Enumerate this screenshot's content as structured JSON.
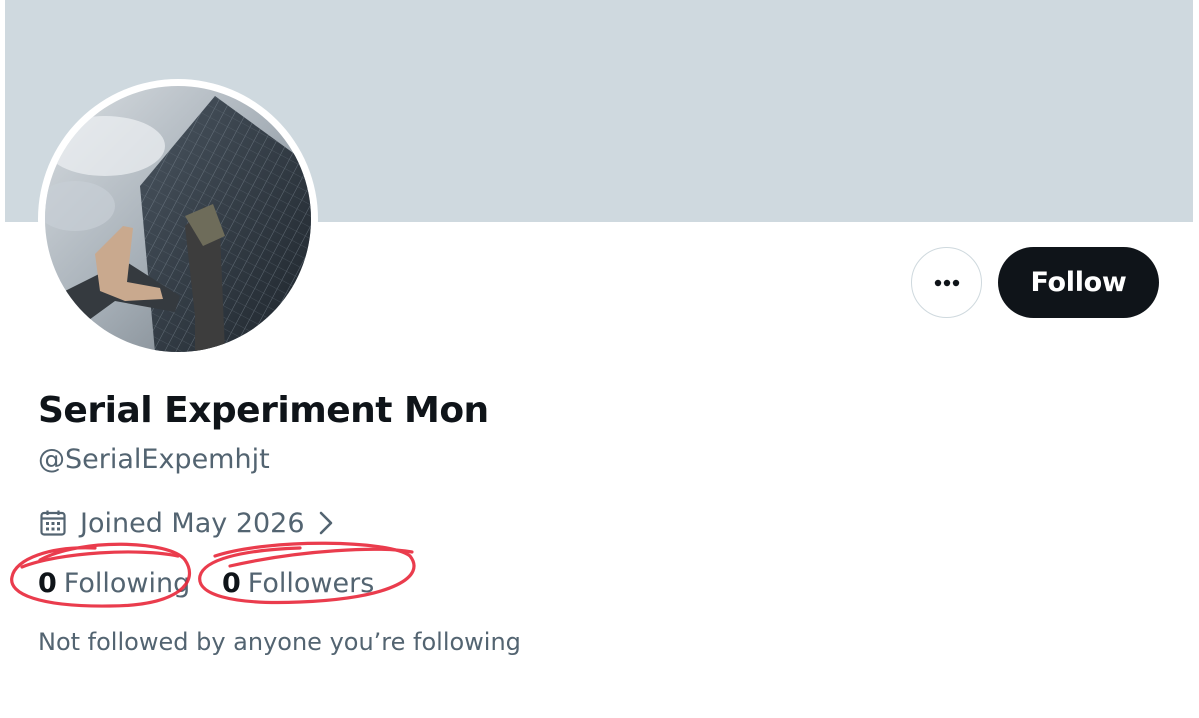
{
  "profile": {
    "display_name": "Serial Experiment Mon",
    "handle": "@SerialExpemhjt",
    "joined": "Joined May 2026",
    "followed_by": "Not followed by anyone you’re following"
  },
  "stats": {
    "following_count": "0",
    "following_label": "Following",
    "followers_count": "0",
    "followers_label": "Followers"
  },
  "actions": {
    "follow_label": "Follow",
    "more_icon": "more-horizontal-icon"
  },
  "icons": {
    "calendar": "calendar-icon",
    "chevron": "chevron-right-icon"
  },
  "colors": {
    "banner": "#cfd9df",
    "primary_text": "#0f1419",
    "secondary_text": "#536471",
    "follow_button_bg": "#0f1419",
    "follow_button_text": "#ffffff",
    "annotation_circle": "#e8283a"
  }
}
